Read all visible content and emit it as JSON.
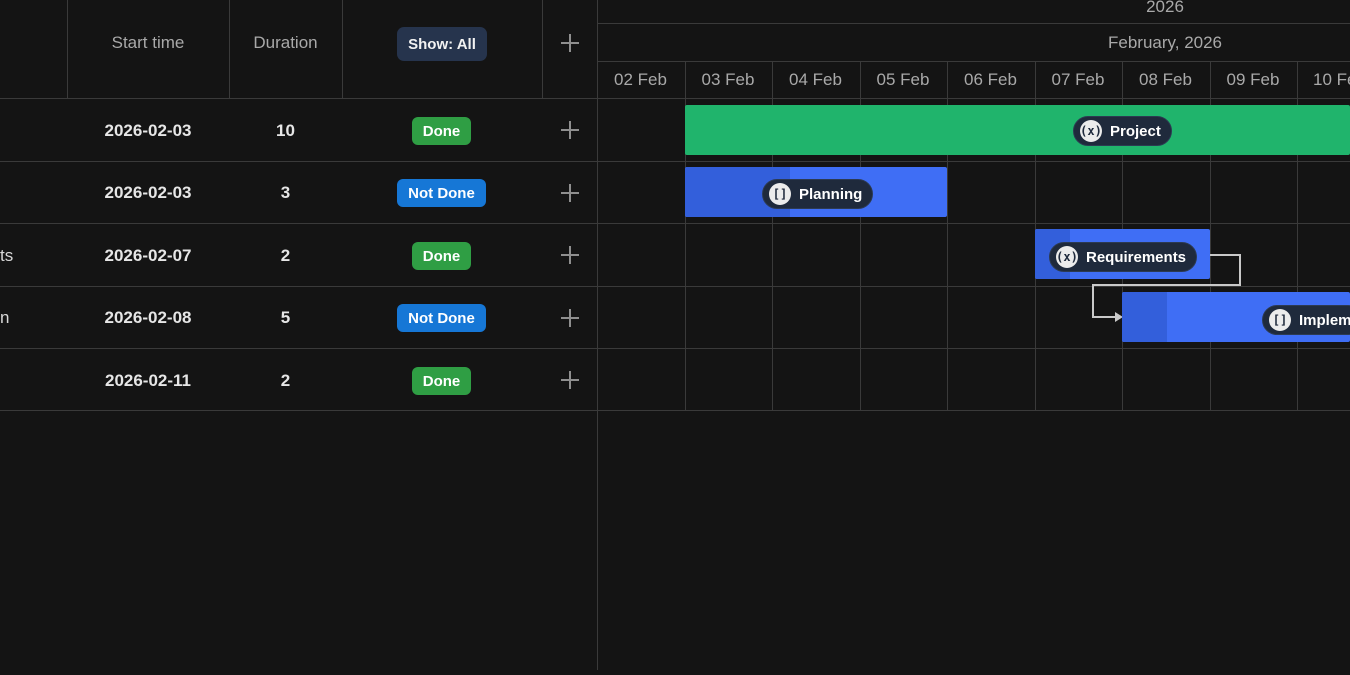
{
  "columns": {
    "start_time": "Start time",
    "duration": "Duration",
    "show_filter": "Show: All"
  },
  "timeline": {
    "year": "2026",
    "month": "February, 2026",
    "days": [
      "02 Feb",
      "03 Feb",
      "04 Feb",
      "05 Feb",
      "06 Feb",
      "07 Feb",
      "08 Feb",
      "09 Feb",
      "10 Fe"
    ]
  },
  "rows": [
    {
      "name": "",
      "start": "2026-02-03",
      "duration": "10",
      "status": "Done"
    },
    {
      "name": "",
      "start": "2026-02-03",
      "duration": "3",
      "status": "Not Done"
    },
    {
      "name": "ts",
      "start": "2026-02-07",
      "duration": "2",
      "status": "Done"
    },
    {
      "name": "n",
      "start": "2026-02-08",
      "duration": "5",
      "status": "Not Done"
    },
    {
      "name": "",
      "start": "2026-02-11",
      "duration": "2",
      "status": "Done"
    }
  ],
  "bars": [
    {
      "label": "Project",
      "icon": "(x)",
      "icon_name": "variable-icon",
      "color": "#20b46c"
    },
    {
      "label": "Planning",
      "icon": "[]",
      "icon_name": "stop-icon",
      "color": "#3f6ef5",
      "progress": 0.4
    },
    {
      "label": "Requirements",
      "icon": "(x)",
      "icon_name": "variable-icon",
      "color": "#3f6ef5",
      "progress": 0.2
    },
    {
      "label": "Implem",
      "icon": "[]",
      "icon_name": "stop-icon",
      "color": "#3f6ef5",
      "progress": 0.2
    }
  ],
  "colors": {
    "background": "#141414",
    "grid_line": "#3a3a3a",
    "done": "#2f9e44",
    "not_done": "#1677d6",
    "filter_button": "#26344d"
  }
}
